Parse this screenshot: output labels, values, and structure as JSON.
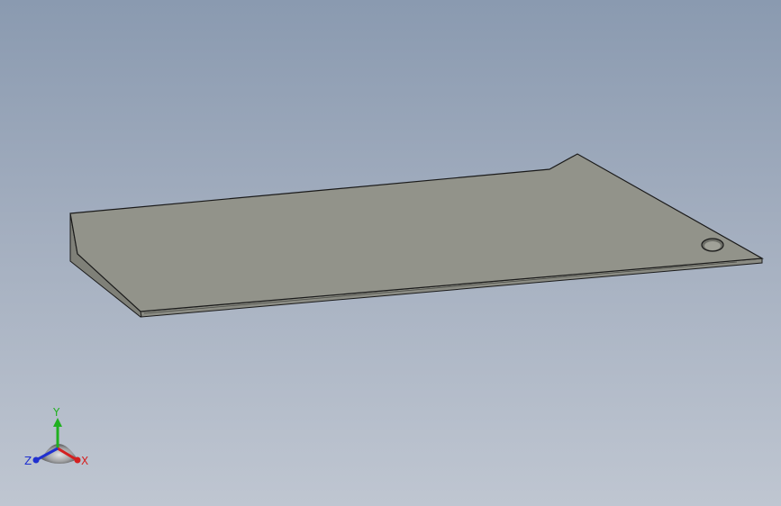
{
  "viewport": {
    "background_top": "#8a9ab0",
    "background_bottom": "#bfc6d1"
  },
  "model": {
    "part": "sheet-metal-plate",
    "face_color": "#92938a",
    "edge_color": "#7d7e76",
    "outline_color": "#1a1a1a",
    "hole": "circular-hole"
  },
  "triad": {
    "x_label": "X",
    "y_label": "Y",
    "z_label": "Z",
    "x_color": "#d42020",
    "y_color": "#20b020",
    "z_color": "#2030d0"
  }
}
